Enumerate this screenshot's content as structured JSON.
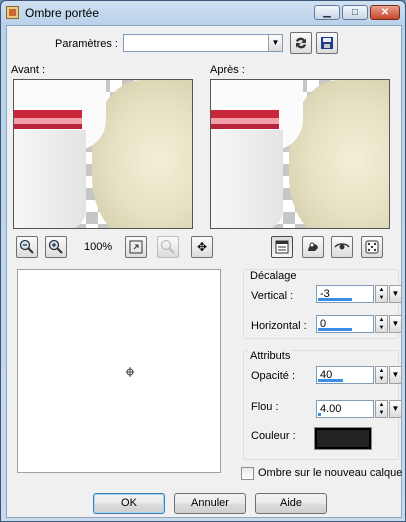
{
  "window": {
    "title": "Ombre portée"
  },
  "titlebar_buttons": {
    "minimize": "▁",
    "maximize": "□",
    "close": "✕"
  },
  "params": {
    "label": "Paramètres :",
    "value": ""
  },
  "previews": {
    "before_label": "Avant :",
    "after_label": "Après :"
  },
  "zoom": {
    "level": "100%"
  },
  "offset": {
    "group_label": "Décalage",
    "vertical_label": "Vertical :",
    "vertical_value": "-3",
    "vertical_fill": 0.6,
    "horizontal_label": "Horizontal :",
    "horizontal_value": "0",
    "horizontal_fill": 0.6
  },
  "attributes": {
    "group_label": "Attributs",
    "opacity_label": "Opacité :",
    "opacity_value": "40",
    "opacity_fill": 0.45,
    "blur_label": "Flou :",
    "blur_value": "4.00",
    "blur_fill": 0.05,
    "color_label": "Couleur :",
    "color_value": "#222222"
  },
  "new_layer": {
    "label": "Ombre sur le nouveau calque",
    "checked": false
  },
  "buttons": {
    "ok": "OK",
    "cancel": "Annuler",
    "help": "Aide"
  },
  "icons": [
    "app-icon",
    "dropdown-arrow-icon",
    "reset-icon",
    "save-icon",
    "zoom-out-icon",
    "zoom-in-icon",
    "fit-icon",
    "zoom-disabled-icon",
    "pan-icon",
    "view-icon",
    "shadow-icon",
    "eye-icon",
    "dice-icon"
  ]
}
